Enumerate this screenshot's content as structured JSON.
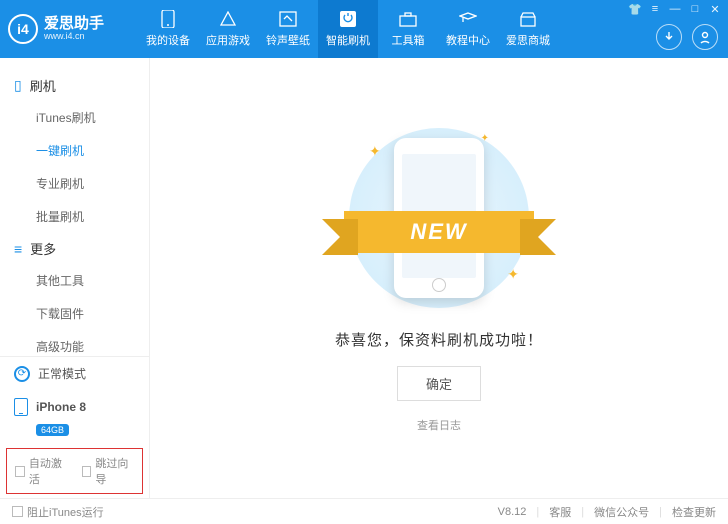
{
  "app": {
    "name": "爱思助手",
    "url": "www.i4.cn",
    "logo_text": "i4"
  },
  "nav": [
    {
      "label": "我的设备"
    },
    {
      "label": "应用游戏"
    },
    {
      "label": "铃声壁纸"
    },
    {
      "label": "智能刷机"
    },
    {
      "label": "工具箱"
    },
    {
      "label": "教程中心"
    },
    {
      "label": "爱思商城"
    }
  ],
  "sidebar": {
    "section1": {
      "title": "刷机",
      "items": [
        "iTunes刷机",
        "一键刷机",
        "专业刷机",
        "批量刷机"
      ]
    },
    "section2": {
      "title": "更多",
      "items": [
        "其他工具",
        "下载固件",
        "高级功能"
      ]
    },
    "mode": "正常模式",
    "device": {
      "name": "iPhone 8",
      "storage": "64GB"
    },
    "checks": [
      "自动激活",
      "跳过向导"
    ]
  },
  "main": {
    "ribbon": "NEW",
    "message": "恭喜您，保资料刷机成功啦！",
    "ok": "确定",
    "log": "查看日志"
  },
  "footer": {
    "block_itunes": "阻止iTunes运行",
    "version": "V8.12",
    "links": [
      "客服",
      "微信公众号",
      "检查更新"
    ]
  }
}
